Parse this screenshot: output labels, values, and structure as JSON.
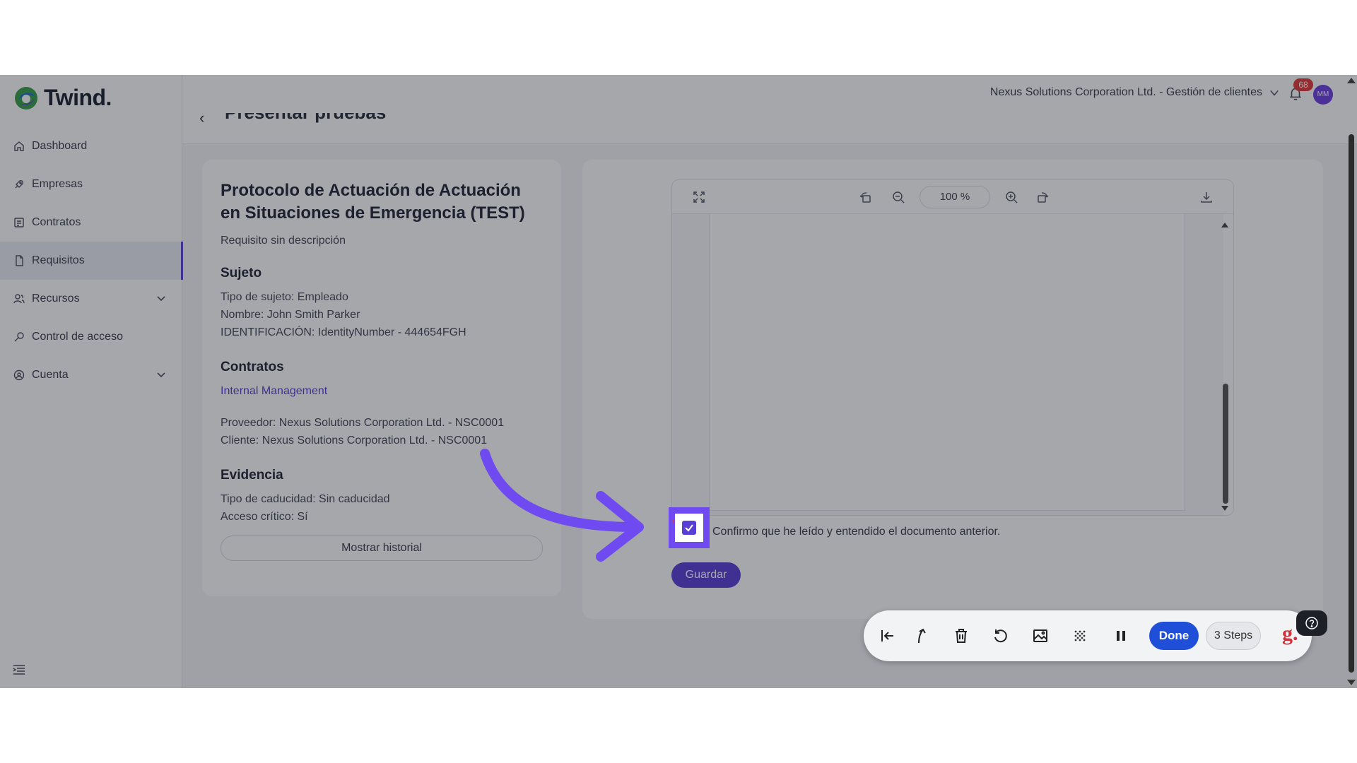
{
  "app": {
    "logo_text": "Twind."
  },
  "sidebar": {
    "items": [
      {
        "label": "Dashboard",
        "icon": "home-icon"
      },
      {
        "label": "Empresas",
        "icon": "rocket-icon"
      },
      {
        "label": "Contratos",
        "icon": "contract-icon"
      },
      {
        "label": "Requisitos",
        "icon": "file-icon",
        "active": true
      },
      {
        "label": "Recursos",
        "icon": "people-icon",
        "expandable": true
      },
      {
        "label": "Control de acceso",
        "icon": "key-icon"
      },
      {
        "label": "Cuenta",
        "icon": "account-icon",
        "expandable": true
      }
    ]
  },
  "header": {
    "organization": "Nexus Solutions Corporation Ltd. - Gestión de clientes",
    "notification_count": "68",
    "avatar_initials": "MM"
  },
  "page": {
    "title": "Presentar pruebas"
  },
  "requirement": {
    "title": "Protocolo de Actuación de Actuación en Situaciones de Emergencia (TEST)",
    "description": "Requisito sin descripción",
    "subject_heading": "Sujeto",
    "subject_type": "Tipo de sujeto: Empleado",
    "subject_name": "Nombre: John Smith Parker",
    "subject_id": "IDENTIFICACIÓN: IdentityNumber - 444654FGH",
    "contracts_heading": "Contratos",
    "contract_link": "Internal Management",
    "provider": "Proveedor: Nexus Solutions Corporation Ltd. - NSC0001",
    "client": "Cliente: Nexus Solutions Corporation Ltd. - NSC0001",
    "evidence_heading": "Evidencia",
    "expiry_type": "Tipo de caducidad: Sin caducidad",
    "critical_access": "Acceso crítico: Sí",
    "history_button": "Mostrar historial"
  },
  "viewer": {
    "zoom": "100 %"
  },
  "confirm": {
    "text": "Confirmo que he leído y entendido el documento anterior.",
    "checked": true,
    "required_mark": "*"
  },
  "save_button": "Guardar",
  "recorder": {
    "done_label": "Done",
    "steps_label": "3 Steps",
    "brand_glyph": "g."
  },
  "colors": {
    "accent": "#5a3fd6",
    "highlight": "#6e4af0",
    "done_blue": "#1f4fd8",
    "badge_red": "#e03a3a"
  }
}
